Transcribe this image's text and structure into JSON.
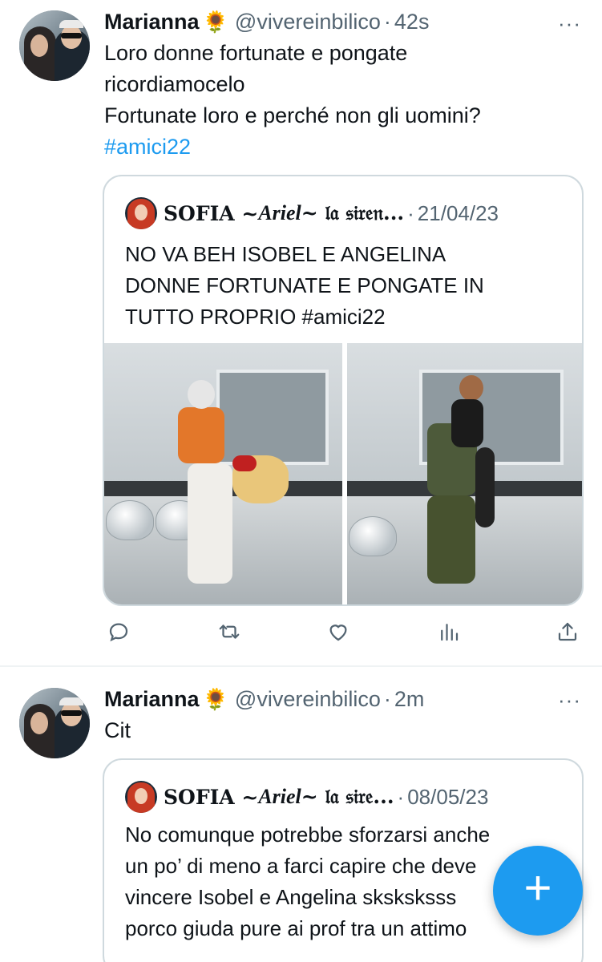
{
  "tweets": [
    {
      "author_name": "Marianna",
      "author_emoji": "🌻",
      "handle": "@vivereinbilico",
      "time": "42s",
      "more": "···",
      "text_lines": [
        "Loro donne fortunate e pongate",
        "ricordiamocelo",
        "Fortunate loro e perché non gli uomini?"
      ],
      "hashtag": "#amici22",
      "quote": {
        "author_name": "SOFIA ~ ",
        "author_ariel": "Ariel",
        "author_rest": " ~ 𝔩𝔞 𝔰𝔦𝔯𝔢𝔫...",
        "date": "21/04/23",
        "text_lines": [
          "NO VA BEH ISOBEL E ANGELINA",
          "DONNE FORTUNATE E PONGATE IN",
          "TUTTO PROPRIO #amici22"
        ]
      }
    },
    {
      "author_name": "Marianna",
      "author_emoji": "🌻",
      "handle": "@vivereinbilico",
      "time": "2m",
      "more": "···",
      "text": "Cit",
      "quote": {
        "author_name": "SOFIA ~ ",
        "author_ariel": "Ariel",
        "author_rest": " ~ 𝔩𝔞 𝔰𝔦𝔯𝔢...",
        "date": "08/05/23",
        "text_lines": [
          "No comunque potrebbe sforzarsi anche",
          "un po’ di meno a farci capire che deve",
          "vincere Isobel e Angelina sksksksss",
          "porco giuda pure ai prof tra un attimo"
        ]
      }
    }
  ],
  "actions": [
    {
      "name": "reply-icon"
    },
    {
      "name": "retweet-icon"
    },
    {
      "name": "like-icon"
    },
    {
      "name": "views-icon"
    },
    {
      "name": "share-icon"
    }
  ],
  "fab": {
    "label": "+",
    "icon": "compose-plus-icon"
  },
  "colors": {
    "link": "#1d9bf0",
    "secondary_text": "#536471",
    "border": "#cfd9de",
    "fab": "#1d9bf0"
  }
}
